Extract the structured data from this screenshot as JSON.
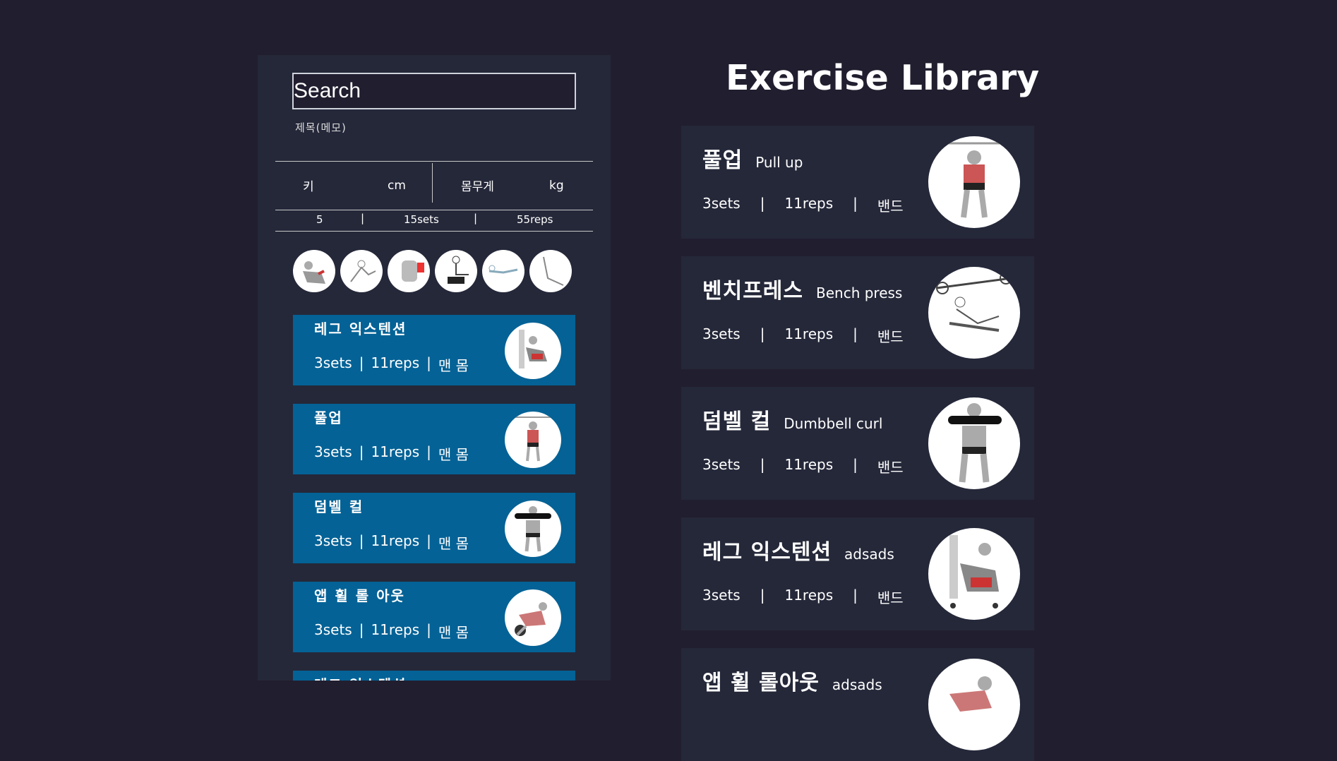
{
  "search": {
    "placeholder": "Search",
    "memo": "제목(메모)"
  },
  "body_stats": {
    "height_label": "키",
    "height_unit": "cm",
    "weight_label": "몸무게",
    "weight_unit": "kg"
  },
  "summary": {
    "count": "5",
    "sets": "15sets",
    "reps": "55reps"
  },
  "thumbnails": [
    "leg-extension-thumb",
    "squat-thumb",
    "back-muscle-thumb",
    "leg-press-thumb",
    "bench-thumb",
    "stretch-thumb"
  ],
  "routine": [
    {
      "name": "레그 익스텐션",
      "sets": "3sets",
      "reps": "11reps",
      "equipment": "맨 몸"
    },
    {
      "name": "풀업",
      "sets": "3sets",
      "reps": "11reps",
      "equipment": "맨 몸"
    },
    {
      "name": "덤벨 컬",
      "sets": "3sets",
      "reps": "11reps",
      "equipment": "맨 몸"
    },
    {
      "name": "앱 휠 롤 아웃",
      "sets": "3sets",
      "reps": "11reps",
      "equipment": "맨 몸"
    },
    {
      "name": "레그 익스텐션",
      "sets": "",
      "reps": "",
      "equipment": ""
    }
  ],
  "library": {
    "title": "Exercise Library",
    "items": [
      {
        "kname": "풀업",
        "ename": "Pull up",
        "sets": "3sets",
        "reps": "11reps",
        "equipment": "밴드"
      },
      {
        "kname": "벤치프레스",
        "ename": "Bench press",
        "sets": "3sets",
        "reps": "11reps",
        "equipment": "밴드"
      },
      {
        "kname": "덤벨 컬",
        "ename": "Dumbbell curl",
        "sets": "3sets",
        "reps": "11reps",
        "equipment": "밴드"
      },
      {
        "kname": "레그 익스텐션",
        "ename": "adsads",
        "sets": "3sets",
        "reps": "11reps",
        "equipment": "밴드"
      },
      {
        "kname": "앱 휠 롤아웃",
        "ename": "adsads",
        "sets": "",
        "reps": "",
        "equipment": ""
      }
    ]
  },
  "separator": "|"
}
